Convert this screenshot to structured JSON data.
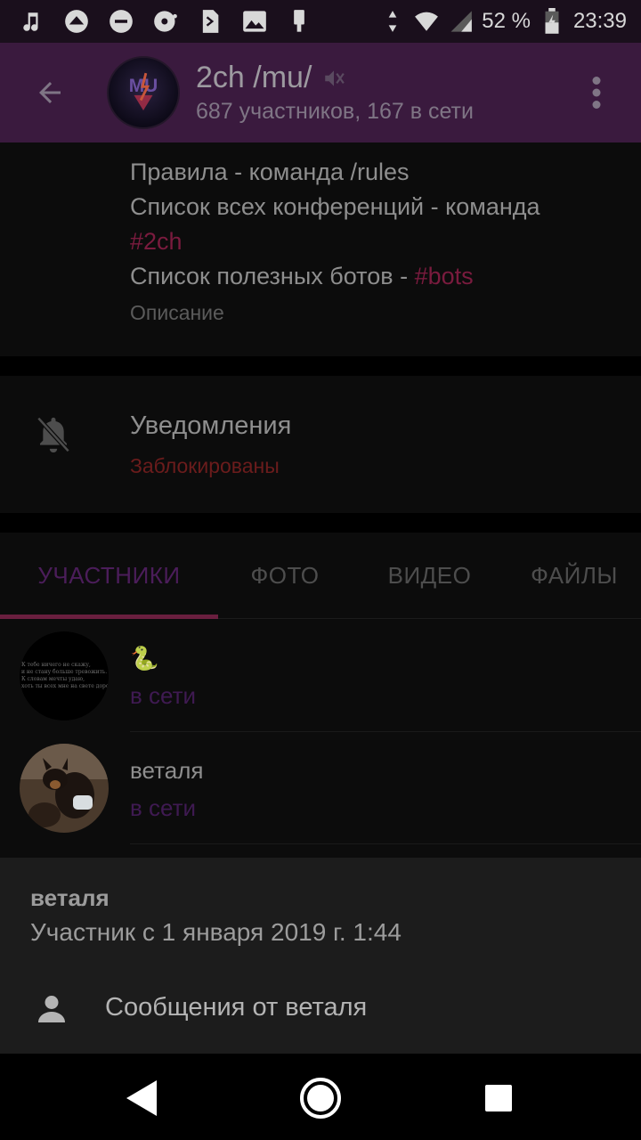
{
  "status_bar": {
    "battery_percent": "52 %",
    "time": "23:39"
  },
  "toolbar": {
    "title": "2ch /mu/",
    "subtitle": "687 участников, 167 в сети",
    "avatar_text": "MU"
  },
  "description": {
    "line1": "Правила - команда /rules",
    "line2": "Список всех конференций - команда",
    "line3_tag": "#2ch",
    "line4_prefix": "Список полезных ботов - ",
    "line4_tag": "#bots",
    "label": "Описание"
  },
  "notifications": {
    "title": "Уведомления",
    "value": "Заблокированы"
  },
  "tabs": [
    {
      "label": "УЧАСТНИКИ",
      "active": true
    },
    {
      "label": "ФОТО",
      "active": false
    },
    {
      "label": "ВИДЕО",
      "active": false
    },
    {
      "label": "ФАЙЛЫ",
      "active": false
    }
  ],
  "members": [
    {
      "name": "🐍",
      "status": "в сети",
      "avatar_lines": [
        "К тебе ничего не скажу,",
        "и не стану больше тревожить.",
        "К словам мечты удаю,",
        "хоть ты всех мне на свете дороже."
      ]
    },
    {
      "name": "веталя",
      "status": "в сети"
    }
  ],
  "sheet": {
    "name": "веталя",
    "since": "Участник с 1 января 2019 г. 1:44",
    "action_label": "Сообщения от веталя"
  },
  "colors": {
    "toolbar_bg": "#3a1a3e",
    "tag_color": "#7a1b3e",
    "online_color": "#3f1a52",
    "active_tab": "#4b1d5a",
    "indicator": "#6a1f3f",
    "blocked_color": "#6b1c1c"
  }
}
